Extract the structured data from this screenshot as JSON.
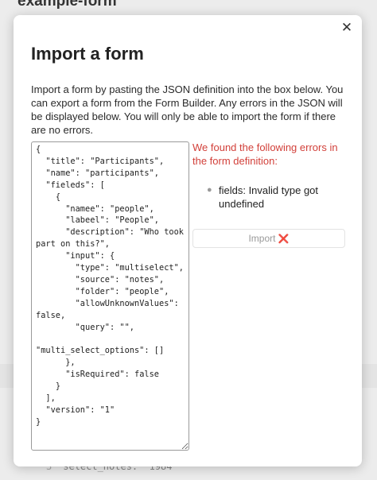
{
  "background": {
    "title": "example-form",
    "code_line_number": "3",
    "code_line": "select_notes: \"1984\""
  },
  "modal": {
    "close_icon": "✕",
    "title": "Import a form",
    "description": "Import a form by pasting the JSON definition into the box below. You can export a form from the Form Builder. Any errors in the JSON will be displayed below. You will only be able to import the form if there are no errors.",
    "json_value": "{\n  \"title\": \"Participants\",\n  \"name\": \"participants\",\n  \"fieleds\": [\n    {\n      \"namee\": \"people\",\n      \"labeel\": \"People\",\n      \"description\": \"Who took part on this?\",\n      \"input\": {\n        \"type\": \"multiselect\",\n        \"source\": \"notes\",\n        \"folder\": \"people\",\n        \"allowUnknownValues\": false,\n        \"query\": \"\",\n        \"multi_select_options\": []\n      },\n      \"isRequired\": false\n    }\n  ],\n  \"version\": \"1\"\n}",
    "errors_title": "We found the following errors in the form definition:",
    "errors": [
      "fields: Invalid type got undefined"
    ],
    "import_label": "Import",
    "import_icon": "❌",
    "colors": {
      "error_text": "#d2403a",
      "disabled_text": "#999999"
    }
  }
}
